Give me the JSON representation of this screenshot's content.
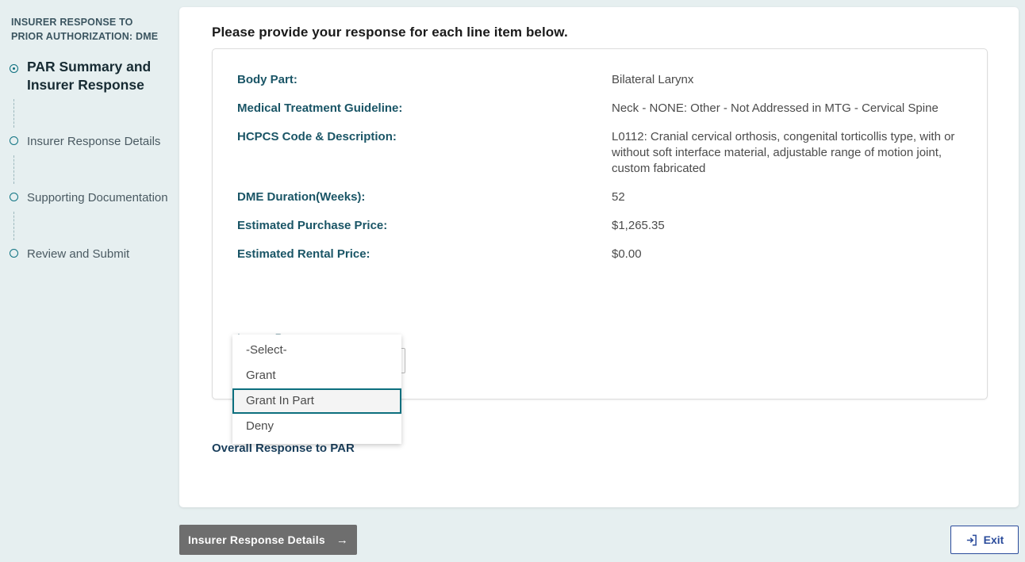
{
  "sidebar": {
    "title": "INSURER RESPONSE TO PRIOR AUTHORIZATION: DME",
    "steps": [
      {
        "label": "PAR Summary and Insurer Response",
        "active": true
      },
      {
        "label": "Insurer Response Details",
        "active": false
      },
      {
        "label": "Supporting Documentation",
        "active": false
      },
      {
        "label": "Review and Submit",
        "active": false
      }
    ]
  },
  "main": {
    "heading": "Please provide your response for each line item below.",
    "fields": [
      {
        "label": "Body Part:",
        "value": "Bilateral Larynx"
      },
      {
        "label": "Medical Treatment Guideline:",
        "value": "Neck - NONE: Other - Not Addressed in MTG - Cervical Spine"
      },
      {
        "label": "HCPCS Code & Description:",
        "value": "L0112: Cranial cervical orthosis, congenital torticollis type, with or without soft interface material, adjustable range of motion joint, custom fabricated"
      },
      {
        "label": "DME Duration(Weeks):",
        "value": "52"
      },
      {
        "label": "Estimated Purchase Price:",
        "value": "$1,265.35"
      },
      {
        "label": "Estimated Rental Price:",
        "value": "$0.00"
      }
    ],
    "insurer_response": {
      "label": "Insurer Response",
      "selected": "-Select-",
      "options": [
        {
          "label": "-Select-",
          "highlighted": false
        },
        {
          "label": "Grant",
          "highlighted": false
        },
        {
          "label": "Grant In Part",
          "highlighted": true
        },
        {
          "label": "Deny",
          "highlighted": false
        }
      ]
    },
    "overall_heading": "Overall Response to PAR"
  },
  "footer": {
    "next_label": "Insurer Response Details",
    "next_arrow": "→",
    "exit_label": "Exit"
  },
  "colors": {
    "page_background": "#e6eff0",
    "accent_teal": "#0c6f7e",
    "label_teal": "#1a5566",
    "exit_blue": "#2a4b9b",
    "next_gray": "#6e6e6e"
  }
}
